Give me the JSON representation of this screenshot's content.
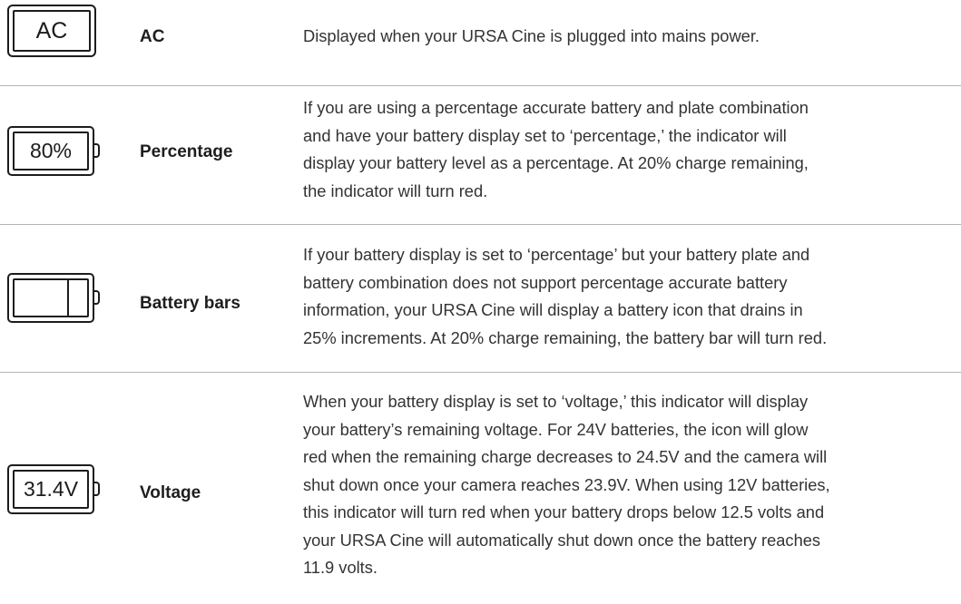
{
  "rows": [
    {
      "icon_text": "AC",
      "label": "AC",
      "lines": [
        "Displayed when your URSA Cine is plugged into mains power."
      ]
    },
    {
      "icon_text": "80%",
      "label": "Percentage",
      "lines": [
        "If you are using a percentage accurate battery and plate combination",
        "and have your battery display set to ‘percentage,’ the indicator will",
        "display your battery level as a percentage. At 20% charge remaining,",
        "the indicator will turn red."
      ]
    },
    {
      "icon_text": "",
      "label": "Battery bars",
      "lines": [
        "If your battery display is set to ‘percentage’ but your battery plate and",
        "battery combination does not support percentage accurate battery",
        "information, your URSA Cine will display a battery icon that drains in",
        "25% increments. At 20% charge remaining, the battery bar will turn red."
      ]
    },
    {
      "icon_text": "31.4V",
      "label": "Voltage",
      "lines": [
        "When your battery display is set to ‘voltage,’ this indicator will display",
        "your battery’s remaining voltage. For 24V batteries, the icon will glow",
        "red when the remaining charge decreases to 24.5V and the camera will",
        "shut down once your camera reaches 23.9V. When using 12V batteries,",
        "this indicator will turn red when your battery drops below 12.5 volts and",
        "your URSA Cine will automatically shut down once the battery reaches",
        "11.9 volts."
      ]
    }
  ]
}
